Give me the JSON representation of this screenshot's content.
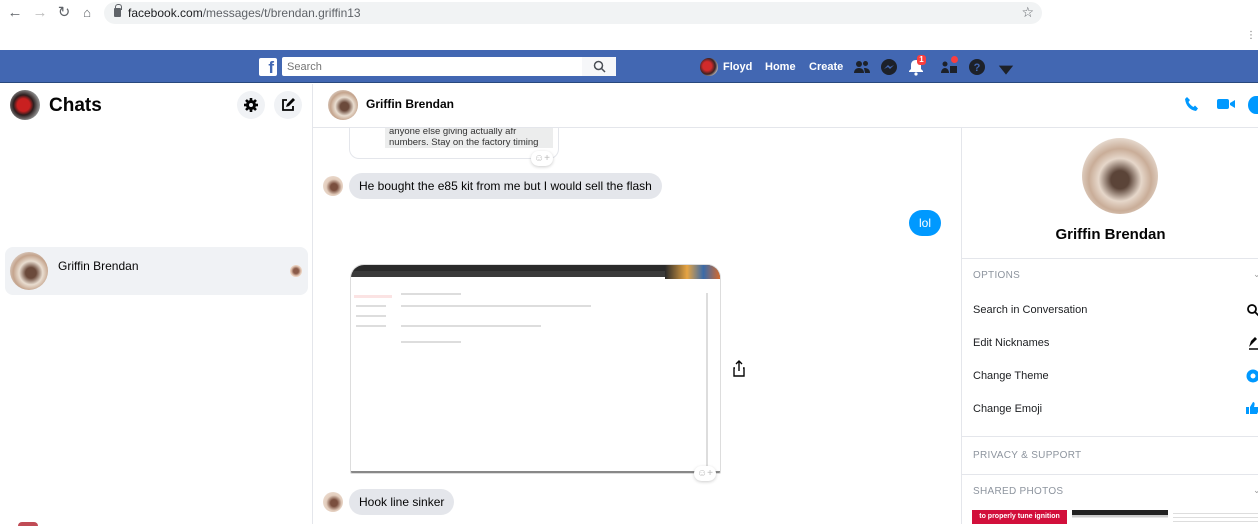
{
  "browser": {
    "url_host": "facebook.com",
    "url_path": "/messages/t/brendan.griffin13",
    "icons": [
      "back-icon",
      "forward-icon",
      "reload-icon",
      "home-icon",
      "lock-icon",
      "bookmark-star-icon"
    ]
  },
  "fb_bar": {
    "search_placeholder": "Search",
    "user_name": "Floyd",
    "links": [
      "Home",
      "Create"
    ],
    "notification_count": "1",
    "icons": [
      "friends-icon",
      "messenger-icon",
      "notifications-icon",
      "friend-requests-icon",
      "help-icon",
      "account-menu-caret-icon"
    ]
  },
  "left": {
    "title": "Chats",
    "conversations": [
      {
        "name": "Griffin Brendan",
        "selected": true
      }
    ]
  },
  "thread": {
    "contact_name": "Griffin Brendan",
    "quoted_text": [
      "anyone else giving actually afr",
      "numbers. Stay on the factory timing"
    ],
    "messages": [
      {
        "from": "them",
        "text": "He bought the e85 kit from me but I would sell the flash"
      },
      {
        "from": "me",
        "text": "lol"
      },
      {
        "from": "them",
        "type": "image",
        "alt": "Screenshot of Gmail email thread"
      },
      {
        "from": "them",
        "text": "Hook line sinker"
      }
    ]
  },
  "info": {
    "name": "Griffin Brendan",
    "options_title": "OPTIONS",
    "options": [
      "Search in Conversation",
      "Edit Nicknames",
      "Change Theme",
      "Change Emoji"
    ],
    "privacy_title": "PRIVACY & SUPPORT",
    "photos_title": "SHARED PHOTOS",
    "photo_caption": "to properly tune ignition",
    "accent": "#0099ff"
  }
}
